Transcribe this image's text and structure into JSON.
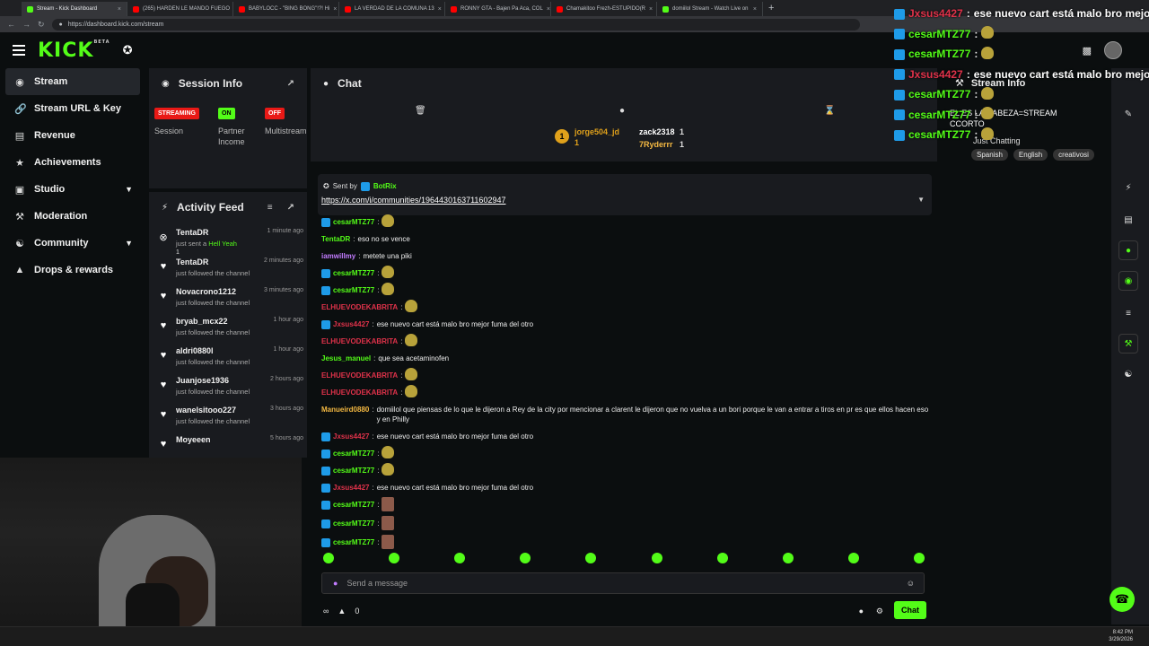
{
  "browser": {
    "tabs": [
      {
        "label": "Stream - Kick Dashboard",
        "icon": "kick"
      },
      {
        "label": "(265) HARDEN LE MANDO FUEGO",
        "icon": "youtube"
      },
      {
        "label": "BABYLOCC - \"BING BONG\"!?! Hi",
        "icon": "youtube"
      },
      {
        "label": "LA VERDAD DE LA COMUNA 13",
        "icon": "youtube"
      },
      {
        "label": "RONNY GTA - Bajen Pa Aca, COL",
        "icon": "youtube"
      },
      {
        "label": "Chamakitoo Frezh-ESTUPIDO(R",
        "icon": "youtube"
      },
      {
        "label": "domiilol Stream - Watch Live on",
        "icon": "kick"
      }
    ],
    "url": "https://dashboard.kick.com/stream"
  },
  "header": {
    "logo": "KICK",
    "logo_sup": "BETA"
  },
  "sidebar": {
    "items": [
      {
        "label": "Stream",
        "icon": "broadcast-icon"
      },
      {
        "label": "Stream URL & Key",
        "icon": "link-icon"
      },
      {
        "label": "Revenue",
        "icon": "chart-icon"
      },
      {
        "label": "Achievements",
        "icon": "trophy-icon"
      },
      {
        "label": "Studio",
        "icon": "studio-icon"
      },
      {
        "label": "Moderation",
        "icon": "wrench-icon"
      },
      {
        "label": "Community",
        "icon": "community-icon"
      },
      {
        "label": "Drops & rewards",
        "icon": "gift-icon"
      }
    ]
  },
  "session": {
    "title": "Session Info",
    "cols": [
      {
        "badge": "STREAMING",
        "label": "Session"
      },
      {
        "badge": "ON",
        "label": "Partner Income"
      },
      {
        "badge": "OFF",
        "label": "Multistream"
      }
    ]
  },
  "activity": {
    "title": "Activity Feed",
    "items": [
      {
        "who": "TentaDR",
        "what_pre": "just sent a ",
        "what_hl": "Hell Yeah",
        "when": "1 minute ago",
        "extra": "1"
      },
      {
        "who": "TentaDR",
        "what": "just followed the channel",
        "when": "2 minutes ago"
      },
      {
        "who": "Novacrono1212",
        "what": "just followed the channel",
        "when": "3 minutes ago"
      },
      {
        "who": "bryab_mcx22",
        "what": "just followed the channel",
        "when": "1 hour ago"
      },
      {
        "who": "aldri0880l",
        "what": "just followed the channel",
        "when": "1 hour ago"
      },
      {
        "who": "Juanjose1936",
        "what": "just followed the channel",
        "when": "2 hours ago"
      },
      {
        "who": "wanelsitooo227",
        "what": "just followed the channel",
        "when": "3 hours ago"
      },
      {
        "who": "Moyeeen",
        "what": "",
        "when": "5 hours ago"
      }
    ]
  },
  "chat": {
    "title": "Chat",
    "leaders": [
      {
        "name": "jorge504_jd",
        "count": "1"
      },
      {
        "name": "zack2318",
        "count": "1"
      },
      {
        "name": "7Ryderrr",
        "count": "1"
      }
    ],
    "pinned_by_prefix": "Sent by",
    "pinned_by": "BotRix",
    "pinned_link": "https://x.com/i/communities/1964430163711602947",
    "messages": [
      {
        "user": "cesarMTZ77",
        "color": "#53fc18",
        "badge": true,
        "text": "",
        "emote": "emote"
      },
      {
        "user": "TentaDR",
        "color": "#53fc18",
        "badge": false,
        "text": "eso no se vence"
      },
      {
        "user": "iamwillmy",
        "color": "#c27cff",
        "badge": false,
        "text": "metete una piki"
      },
      {
        "user": "cesarMTZ77",
        "color": "#53fc18",
        "badge": true,
        "text": "",
        "emote": "emote"
      },
      {
        "user": "cesarMTZ77",
        "color": "#53fc18",
        "badge": true,
        "text": "",
        "emote": "emote"
      },
      {
        "user": "ELHUEVODEKABRITA",
        "color": "#e0324a",
        "badge": false,
        "text": "",
        "emote": "emote"
      },
      {
        "user": "Jxsus4427",
        "color": "#e0324a",
        "badge": true,
        "text": "ese nuevo cart está malo bro mejor fuma del otro"
      },
      {
        "user": "ELHUEVODEKABRITA",
        "color": "#e0324a",
        "badge": false,
        "text": "",
        "emote": "emote"
      },
      {
        "user": "Jesus_manuel",
        "color": "#53fc18",
        "badge": false,
        "text": "que sea acetaminofen"
      },
      {
        "user": "ELHUEVODEKABRITA",
        "color": "#e0324a",
        "badge": false,
        "text": "",
        "emote": "emote"
      },
      {
        "user": "ELHUEVODEKABRITA",
        "color": "#e0324a",
        "badge": false,
        "text": "",
        "emote": "emote"
      },
      {
        "user": "Manueird0880",
        "color": "#f5b942",
        "badge": false,
        "text": "domiilol que piensas de lo que le dijeron a Rey de la city por mencionar a clarent le dijeron que no vuelva a un bori porque le van a entrar a tiros en pr es que ellos hacen eso y en Philly"
      },
      {
        "user": "Jxsus4427",
        "color": "#e0324a",
        "badge": true,
        "text": "ese nuevo cart está malo bro mejor fuma del otro"
      },
      {
        "user": "cesarMTZ77",
        "color": "#53fc18",
        "badge": true,
        "text": "",
        "emote": "emote"
      },
      {
        "user": "cesarMTZ77",
        "color": "#53fc18",
        "badge": true,
        "text": "",
        "emote": "emote"
      },
      {
        "user": "Jxsus4427",
        "color": "#e0324a",
        "badge": true,
        "text": "ese nuevo cart está malo bro mejor fuma del otro"
      },
      {
        "user": "cesarMTZ77",
        "color": "#53fc18",
        "badge": true,
        "text": "",
        "emote": "face"
      },
      {
        "user": "cesarMTZ77",
        "color": "#53fc18",
        "badge": true,
        "text": "",
        "emote": "face"
      },
      {
        "user": "cesarMTZ77",
        "color": "#53fc18",
        "badge": true,
        "text": "",
        "emote": "face"
      }
    ],
    "input_placeholder": "Send a message",
    "footer_count": "0",
    "chat_button": "Chat"
  },
  "stream_info": {
    "title": "Stream Info",
    "stream_title": "EL ES LA CABEZA=STREAM CCORTO",
    "category": "Just Chatting",
    "tags": [
      "Spanish",
      "English",
      "creativosi"
    ]
  },
  "overlay_chat": [
    {
      "user": "Jxsus4427",
      "color": "#e0324a",
      "text": "ese nuevo cart está malo bro mejor f"
    },
    {
      "user": "cesarMTZ77",
      "color": "#53fc18",
      "text": ""
    },
    {
      "user": "cesarMTZ77",
      "color": "#53fc18",
      "text": ""
    },
    {
      "user": "Jxsus4427",
      "color": "#e0324a",
      "text": "ese nuevo cart está malo bro mejor f"
    },
    {
      "user": "cesarMTZ77",
      "color": "#53fc18",
      "text": ""
    },
    {
      "user": "cesarMTZ77",
      "color": "#53fc18",
      "text": ""
    },
    {
      "user": "cesarMTZ77",
      "color": "#53fc18",
      "text": ""
    }
  ],
  "taskbar": {
    "time": "8:42 PM",
    "date": "3/29/2026"
  },
  "colors": {
    "accent": "#53fc18",
    "panel": "#191b1f",
    "bg": "#0b0e0f",
    "live": "#e91916"
  }
}
